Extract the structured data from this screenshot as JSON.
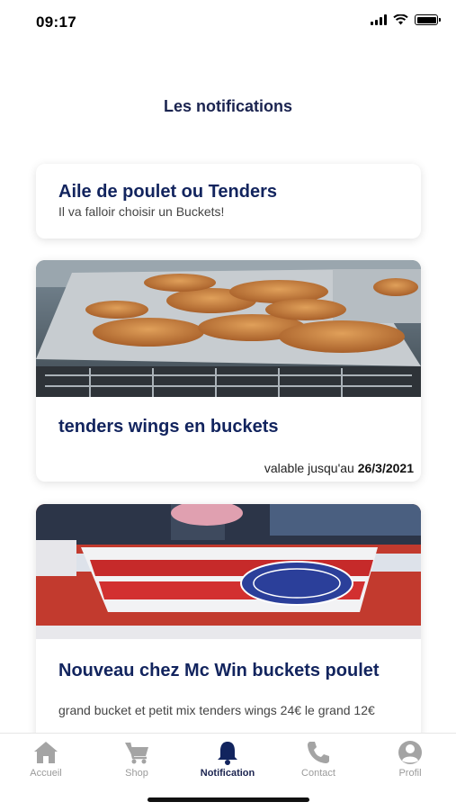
{
  "status_bar": {
    "time": "09:17"
  },
  "page_title": "Les notifications",
  "notifications": [
    {
      "title": "Aile de poulet ou Tenders",
      "description": "Il va falloir choisir un Buckets!"
    },
    {
      "title": "tenders wings en buckets",
      "validity_prefix": "valable jusqu'au",
      "validity_date": "26/3/2021",
      "image": "fried chicken tenders on a tray"
    },
    {
      "title": "Nouveau chez Mc Win buckets poulet",
      "description": "grand bucket et petit mix tenders wings 24€ le grand 12€",
      "image": "Mc Win chicken bucket"
    }
  ],
  "tabs": [
    {
      "label": "Accueil",
      "icon": "home-icon"
    },
    {
      "label": "Shop",
      "icon": "cart-icon"
    },
    {
      "label": "Notification",
      "icon": "bell-icon",
      "active": true
    },
    {
      "label": "Contact",
      "icon": "phone-icon"
    },
    {
      "label": "Profil",
      "icon": "user-icon"
    }
  ],
  "colors": {
    "primary": "#12245e",
    "inactive": "#9a9a9a",
    "tab_active_icon": "#12245e"
  }
}
